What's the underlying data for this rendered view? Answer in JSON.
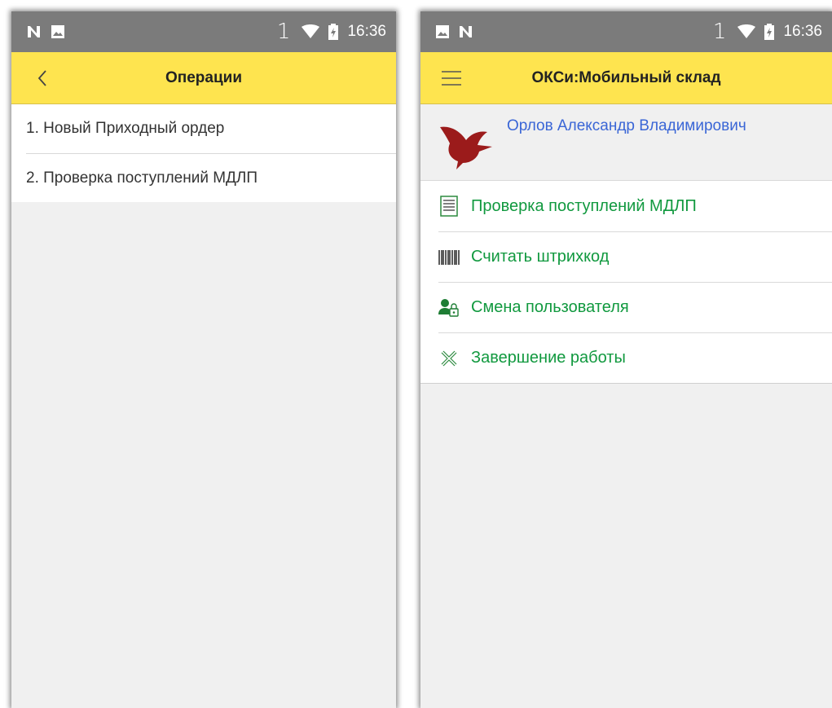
{
  "left_screen": {
    "status": {
      "signal_text": "1",
      "time": "16:36"
    },
    "appbar": {
      "title": "Операции",
      "back_icon": "chevron-left-icon"
    },
    "items": [
      {
        "label": "1. Новый Приходный ордер"
      },
      {
        "label": "2. Проверка поступлений МДЛП"
      }
    ]
  },
  "right_screen": {
    "status": {
      "signal_text": "1",
      "time": "16:36"
    },
    "appbar": {
      "title": "ОКСи:Мобильный склад",
      "menu_icon": "hamburger-menu-icon"
    },
    "profile": {
      "name": "Орлов Александр Владимирович",
      "logo_icon": "bird-logo-icon"
    },
    "menu": [
      {
        "label": "Проверка поступлений МДЛП",
        "icon": "document-icon"
      },
      {
        "label": "Считать штрихкод",
        "icon": "barcode-icon"
      },
      {
        "label": "Смена пользователя",
        "icon": "user-lock-icon"
      },
      {
        "label": "Завершение работы",
        "icon": "close-icon"
      }
    ]
  },
  "colors": {
    "appbar": "#fee44f",
    "statusbar": "#7b7b7b",
    "menu_text": "#11993f",
    "profile_name": "#3a66d6",
    "logo": "#9b1b1b"
  }
}
